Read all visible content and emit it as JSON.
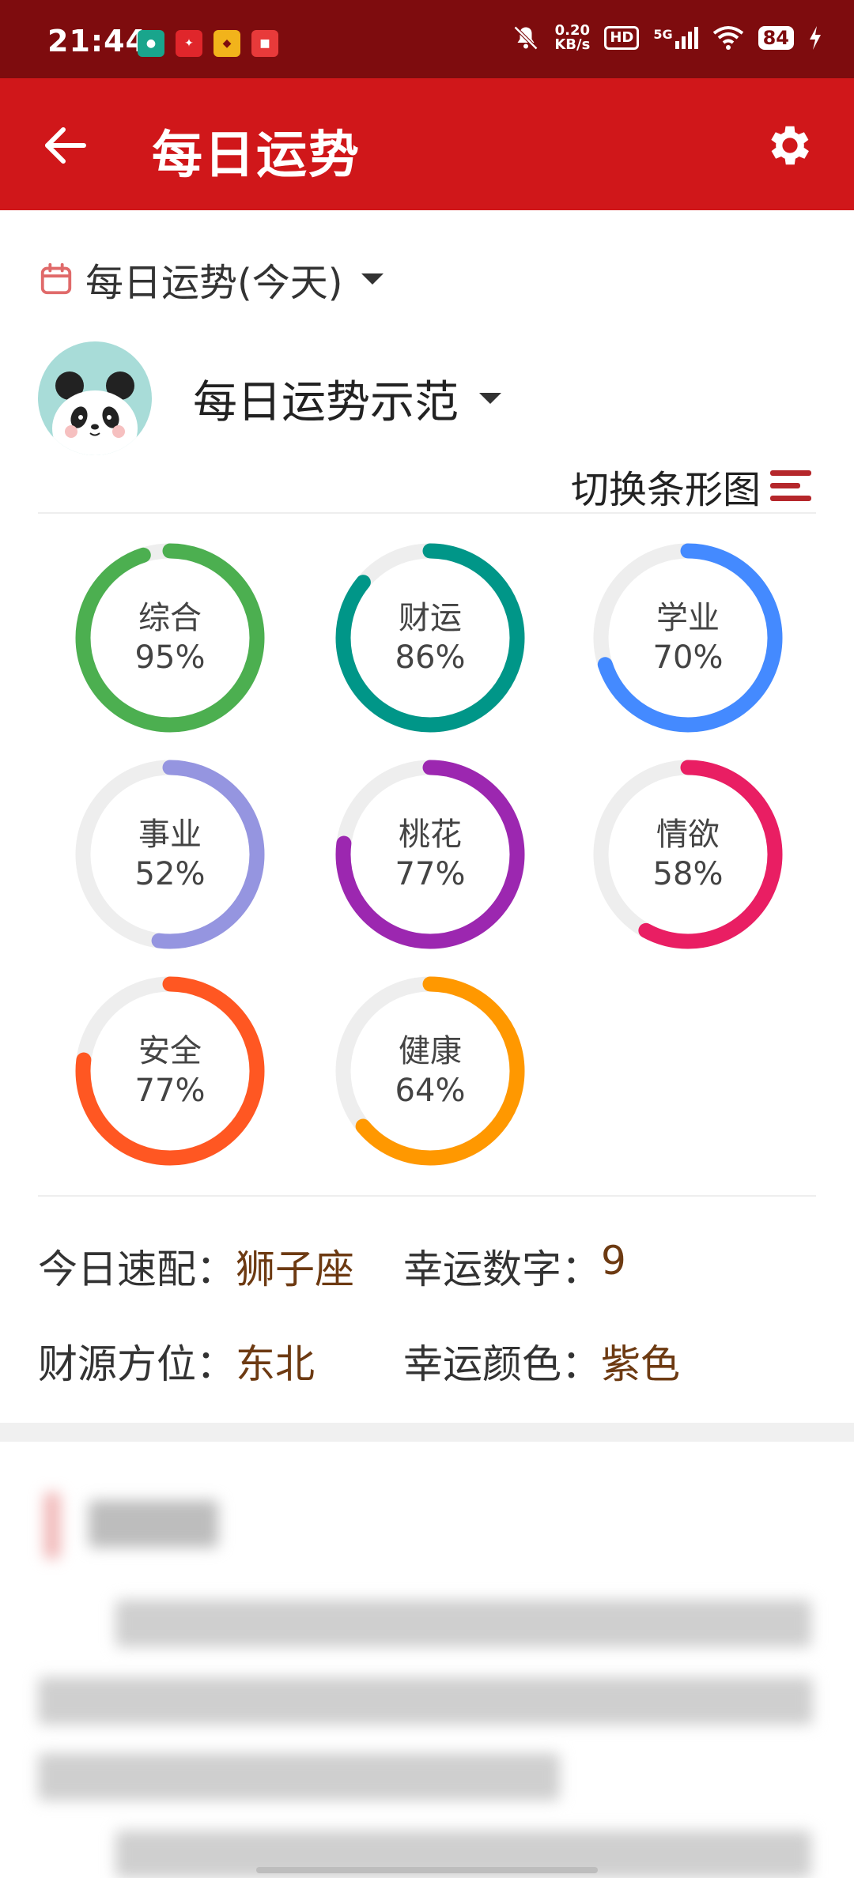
{
  "status_bar": {
    "time": "21:44",
    "net_speed_value": "0.20",
    "net_speed_unit": "KB/s",
    "hd": "HD",
    "signal": "5G",
    "battery": "84",
    "icons": [
      "mute-bell-icon",
      "wifi-icon",
      "charging-icon"
    ]
  },
  "app_bar": {
    "title": "每日运势"
  },
  "date_selector": {
    "label": "每日运势(今天)"
  },
  "profile": {
    "name": "每日运势示范"
  },
  "switch_chart": {
    "label": "切换条形图"
  },
  "chart_data": {
    "type": "ring",
    "series": [
      {
        "label": "综合",
        "value": 95,
        "text": "95%",
        "color": "#4caf50"
      },
      {
        "label": "财运",
        "value": 86,
        "text": "86%",
        "color": "#009688"
      },
      {
        "label": "学业",
        "value": 70,
        "text": "70%",
        "color": "#448aff"
      },
      {
        "label": "事业",
        "value": 52,
        "text": "52%",
        "color": "#9595e0"
      },
      {
        "label": "桃花",
        "value": 77,
        "text": "77%",
        "color": "#9c27b0"
      },
      {
        "label": "情欲",
        "value": 58,
        "text": "58%",
        "color": "#e91e63"
      },
      {
        "label": "安全",
        "value": 77,
        "text": "77%",
        "color": "#ff5722"
      },
      {
        "label": "健康",
        "value": 64,
        "text": "64%",
        "color": "#ff9800"
      }
    ],
    "track_color": "#eeeeee"
  },
  "info": {
    "match_label": "今日速配：",
    "match_value": "狮子座",
    "lucky_number_label": "幸运数字：",
    "lucky_number_value": "9",
    "wealth_direction_label": "财源方位：",
    "wealth_direction_value": "东北",
    "lucky_color_label": "幸运颜色：",
    "lucky_color_value": "紫色"
  },
  "colors": {
    "status_bar": "#7e0c0e",
    "app_bar": "#d0171a",
    "value_text": "#6d3a12"
  }
}
